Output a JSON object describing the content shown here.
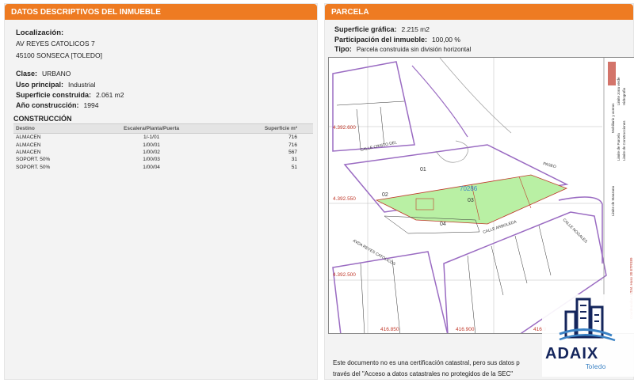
{
  "left": {
    "header": "DATOS DESCRIPTIVOS DEL INMUEBLE",
    "location_label": "Localización:",
    "location_line1": "AV REYES CATOLICOS 7",
    "location_line2": "45100 SONSECA [TOLEDO]",
    "clase_label": "Clase:",
    "clase_value": "URBANO",
    "uso_label": "Uso principal:",
    "uso_value": "Industrial",
    "superficie_label": "Superficie construida:",
    "superficie_value": "2.061 m2",
    "anio_label": "Año construcción:",
    "anio_value": "1994",
    "construccion_title": "CONSTRUCCIÓN",
    "table": {
      "headers": [
        "Destino",
        "Escalera/Planta/Puerta",
        "Superficie m²"
      ],
      "rows": [
        [
          "ALMACEN",
          "1/-1/01",
          "716"
        ],
        [
          "ALMACEN",
          "1/00/01",
          "716"
        ],
        [
          "ALMACEN",
          "1/00/02",
          "567"
        ],
        [
          "SOPORT. 50%",
          "1/00/03",
          "31"
        ],
        [
          "SOPORT. 50%",
          "1/00/04",
          "51"
        ]
      ]
    }
  },
  "right": {
    "header": "PARCELA",
    "sup_label": "Superficie gráfica:",
    "sup_value": "2.215 m2",
    "part_label": "Participación del inmueble:",
    "part_value": "100,00 %",
    "tipo_label": "Tipo:",
    "tipo_value": "Parcela construida sin división horizontal",
    "map": {
      "coord_y1": "4.392.600",
      "coord_y2": "4.392.550",
      "coord_y3": "4.392.500",
      "coord_x1": "416.850",
      "coord_x2": "416.900",
      "coord_x3": "416.9",
      "parcel_ref": "70286",
      "labels": [
        "01",
        "02",
        "03",
        "04"
      ],
      "street1": "CALLE CRISTO DEL",
      "street2": "CALLE ARBOLEDA",
      "street3": "AVDA REYES CATOLICOS",
      "street4": "CALLE NOGALES",
      "street5": "PASEO",
      "legend": [
        "Limite de Manzana",
        "Limite de Parcela",
        "Limite de Construcciones",
        "Mobiliario y aceras",
        "Limite zona verde",
        "Hidrografia"
      ],
      "legend_coords": "Coordenadas U.T.M. Huso 30 ETRS89"
    },
    "note_line1": "Este documento no es una certificación catastral, pero sus datos p",
    "note_line2": "través del \"Acceso a datos catastrales no protegidos de la SEC\""
  },
  "logo": {
    "name": "ADAIX",
    "sub": "Toledo"
  },
  "colors": {
    "accent": "#ee7b22",
    "parcel_fill": "#b9f0a4",
    "block_line": "#9a6bc2",
    "brand_navy": "#14255c"
  }
}
